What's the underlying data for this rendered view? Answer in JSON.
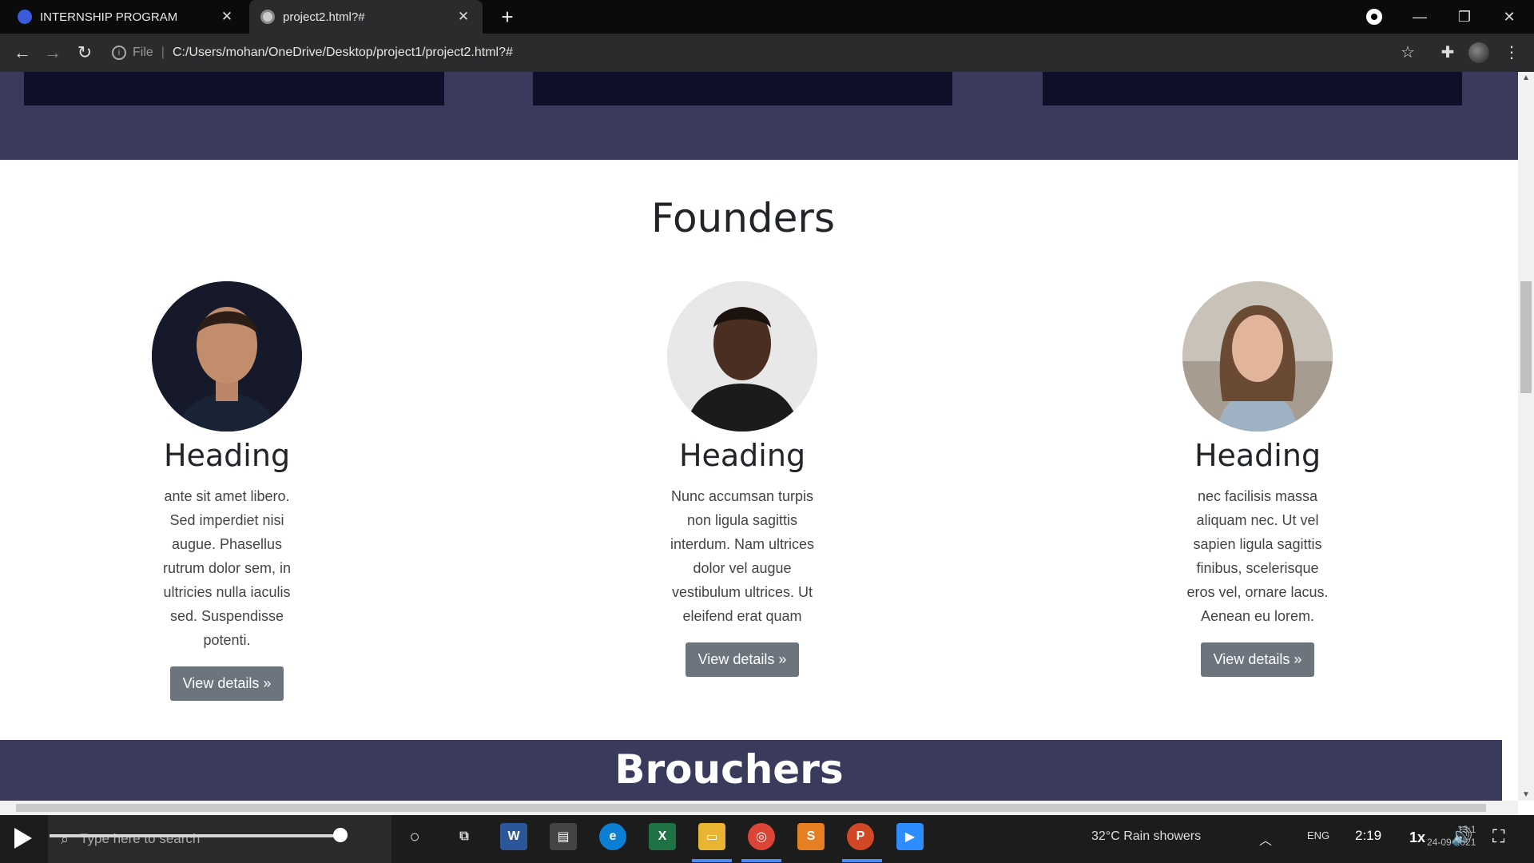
{
  "browser": {
    "tabs": [
      {
        "title": "INTERNSHIP PROGRAM",
        "close": "✕"
      },
      {
        "title": "project2.html?#",
        "close": "✕"
      }
    ],
    "new_tab": "+",
    "window_controls": {
      "minimize": "—",
      "maximize": "❐",
      "close": "✕"
    },
    "nav": {
      "back": "←",
      "forward": "→",
      "reload": "↻"
    },
    "address": {
      "scheme": "File",
      "separator": "|",
      "url": "C:/Users/mohan/OneDrive/Desktop/project1/project2.html?#"
    },
    "toolbar_icons": {
      "bookmark": "☆",
      "extensions": "✚",
      "menu": "⋮"
    }
  },
  "page": {
    "founders_title": "Founders",
    "founders": [
      {
        "heading": "Heading",
        "text": "ante sit amet libero. Sed imperdiet nisi augue. Phasellus rutrum dolor sem, in ultricies nulla iaculis sed. Suspendisse potenti.",
        "button": "View details »"
      },
      {
        "heading": "Heading",
        "text": "Nunc accumsan turpis non ligula sagittis interdum. Nam ultrices dolor vel augue vestibulum ultrices. Ut eleifend erat quam",
        "button": "View details »"
      },
      {
        "heading": "Heading",
        "text": "nec facilisis massa aliquam nec. Ut vel sapien ligula sagittis finibus, scelerisque eros vel, ornare lacus. Aenean eu lorem.",
        "button": "View details »"
      }
    ],
    "brouchers_title": "Brouchers",
    "colors": {
      "band": "#3a3a5c",
      "button": "#6c757d"
    }
  },
  "player": {
    "search_placeholder": "Type here to search",
    "time": "2:19",
    "speed": "1x",
    "weather": "32°C  Rain showers",
    "lang": "ENG",
    "clock_time": "13:1",
    "clock_date": "24-09-2021",
    "progress": 0.52
  }
}
